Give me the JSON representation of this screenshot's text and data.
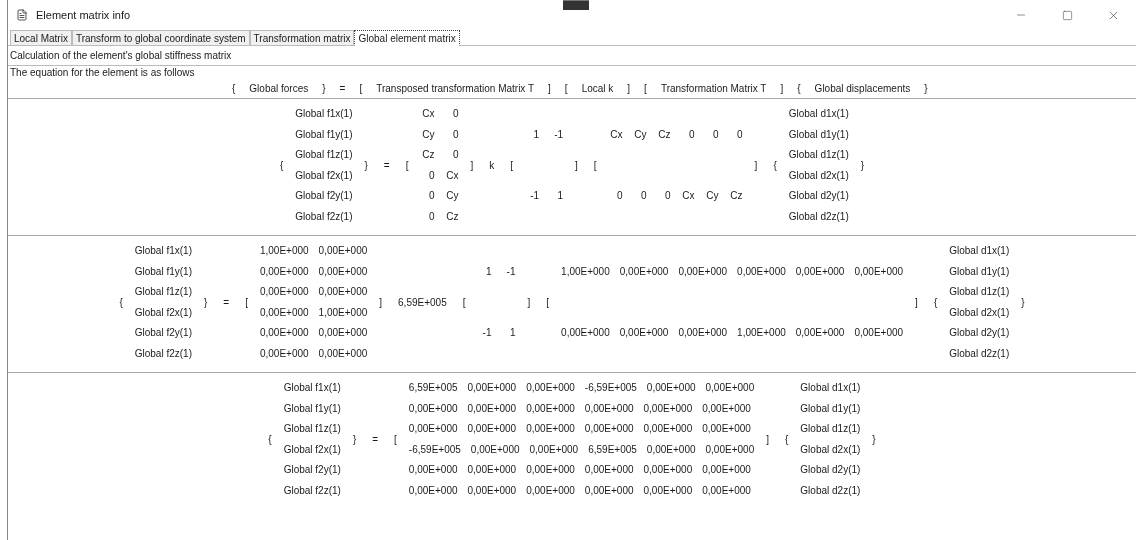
{
  "window": {
    "title": "Element matrix info"
  },
  "tabs": [
    {
      "label": "Local Matrix",
      "selected": false
    },
    {
      "label": "Transform to global coordinate system",
      "selected": false
    },
    {
      "label": "Transformation matrix",
      "selected": false
    },
    {
      "label": "Global element matrix",
      "selected": true
    }
  ],
  "heading": "Calculation of the element's global stiffness matrix",
  "intro": "The equation for the element is as follows",
  "legend": [
    "{",
    "Global forces",
    "}",
    "=",
    "[",
    "Transposed transformation Matrix T",
    "]",
    "[",
    "Local k",
    "]",
    "[",
    "Transformation Matrix T",
    "]",
    "{",
    "Global displacements",
    "}"
  ],
  "equations": [
    {
      "terms": [
        {
          "kind": "symbol",
          "text": "{"
        },
        {
          "kind": "column",
          "cells": [
            "Global f1x(1)",
            "Global f1y(1)",
            "Global f1z(1)",
            "Global f2x(1)",
            "Global f2y(1)",
            "Global f2z(1)"
          ]
        },
        {
          "kind": "symbol",
          "text": "}"
        },
        {
          "kind": "symbol",
          "text": "="
        },
        {
          "kind": "symbol",
          "text": "["
        },
        {
          "kind": "matrix",
          "rows": [
            [
              "Cx",
              "0"
            ],
            [
              "Cy",
              "0"
            ],
            [
              "Cz",
              "0"
            ],
            [
              "0",
              "Cx"
            ],
            [
              "0",
              "Cy"
            ],
            [
              "0",
              "Cz"
            ]
          ]
        },
        {
          "kind": "symbol",
          "text": "]"
        },
        {
          "kind": "symbol",
          "text": "k"
        },
        {
          "kind": "symbol",
          "text": "["
        },
        {
          "kind": "matrix",
          "rows": [
            [
              "1",
              "-1"
            ],
            [
              "-1",
              "1"
            ]
          ]
        },
        {
          "kind": "symbol",
          "text": "]"
        },
        {
          "kind": "symbol",
          "text": "["
        },
        {
          "kind": "matrix",
          "rows": [
            [
              "Cx",
              "Cy",
              "Cz",
              "0",
              "0",
              "0"
            ],
            [
              "0",
              "0",
              "0",
              "Cx",
              "Cy",
              "Cz"
            ]
          ]
        },
        {
          "kind": "symbol",
          "text": "]"
        },
        {
          "kind": "symbol",
          "text": "{"
        },
        {
          "kind": "column",
          "cells": [
            "Global d1x(1)",
            "Global d1y(1)",
            "Global d1z(1)",
            "Global d2x(1)",
            "Global d2y(1)",
            "Global d2z(1)"
          ]
        },
        {
          "kind": "symbol",
          "text": "}"
        }
      ]
    },
    {
      "terms": [
        {
          "kind": "symbol",
          "text": "{"
        },
        {
          "kind": "column",
          "cells": [
            "Global f1x(1)",
            "Global f1y(1)",
            "Global f1z(1)",
            "Global f2x(1)",
            "Global f2y(1)",
            "Global f2z(1)"
          ]
        },
        {
          "kind": "symbol",
          "text": "}"
        },
        {
          "kind": "symbol",
          "text": "="
        },
        {
          "kind": "symbol",
          "text": "["
        },
        {
          "kind": "matrix",
          "rows": [
            [
              "1,00E+000",
              "0,00E+000"
            ],
            [
              "0,00E+000",
              "0,00E+000"
            ],
            [
              "0,00E+000",
              "0,00E+000"
            ],
            [
              "0,00E+000",
              "1,00E+000"
            ],
            [
              "0,00E+000",
              "0,00E+000"
            ],
            [
              "0,00E+000",
              "0,00E+000"
            ]
          ]
        },
        {
          "kind": "symbol",
          "text": "]"
        },
        {
          "kind": "symbol",
          "text": "6,59E+005"
        },
        {
          "kind": "symbol",
          "text": "["
        },
        {
          "kind": "matrix",
          "rows": [
            [
              "1",
              "-1"
            ],
            [
              "-1",
              "1"
            ]
          ]
        },
        {
          "kind": "symbol",
          "text": "]"
        },
        {
          "kind": "symbol",
          "text": "["
        },
        {
          "kind": "matrix",
          "rows": [
            [
              "1,00E+000",
              "0,00E+000",
              "0,00E+000",
              "0,00E+000",
              "0,00E+000",
              "0,00E+000"
            ],
            [
              "0,00E+000",
              "0,00E+000",
              "0,00E+000",
              "1,00E+000",
              "0,00E+000",
              "0,00E+000"
            ]
          ]
        },
        {
          "kind": "symbol",
          "text": "]"
        },
        {
          "kind": "symbol",
          "text": "{"
        },
        {
          "kind": "column",
          "cells": [
            "Global d1x(1)",
            "Global d1y(1)",
            "Global d1z(1)",
            "Global d2x(1)",
            "Global d2y(1)",
            "Global d2z(1)"
          ]
        },
        {
          "kind": "symbol",
          "text": "}"
        }
      ]
    },
    {
      "terms": [
        {
          "kind": "symbol",
          "text": "{"
        },
        {
          "kind": "column",
          "cells": [
            "Global f1x(1)",
            "Global f1y(1)",
            "Global f1z(1)",
            "Global f2x(1)",
            "Global f2y(1)",
            "Global f2z(1)"
          ]
        },
        {
          "kind": "symbol",
          "text": "}"
        },
        {
          "kind": "symbol",
          "text": "="
        },
        {
          "kind": "symbol",
          "text": "["
        },
        {
          "kind": "matrix",
          "rows": [
            [
              "6,59E+005",
              "0,00E+000",
              "0,00E+000",
              "-6,59E+005",
              "0,00E+000",
              "0,00E+000"
            ],
            [
              "0,00E+000",
              "0,00E+000",
              "0,00E+000",
              "0,00E+000",
              "0,00E+000",
              "0,00E+000"
            ],
            [
              "0,00E+000",
              "0,00E+000",
              "0,00E+000",
              "0,00E+000",
              "0,00E+000",
              "0,00E+000"
            ],
            [
              "-6,59E+005",
              "0,00E+000",
              "0,00E+000",
              "6,59E+005",
              "0,00E+000",
              "0,00E+000"
            ],
            [
              "0,00E+000",
              "0,00E+000",
              "0,00E+000",
              "0,00E+000",
              "0,00E+000",
              "0,00E+000"
            ],
            [
              "0,00E+000",
              "0,00E+000",
              "0,00E+000",
              "0,00E+000",
              "0,00E+000",
              "0,00E+000"
            ]
          ]
        },
        {
          "kind": "symbol",
          "text": "]"
        },
        {
          "kind": "symbol",
          "text": "{"
        },
        {
          "kind": "column",
          "cells": [
            "Global d1x(1)",
            "Global d1y(1)",
            "Global d1z(1)",
            "Global d2x(1)",
            "Global d2y(1)",
            "Global d2z(1)"
          ]
        },
        {
          "kind": "symbol",
          "text": "}"
        }
      ]
    }
  ]
}
